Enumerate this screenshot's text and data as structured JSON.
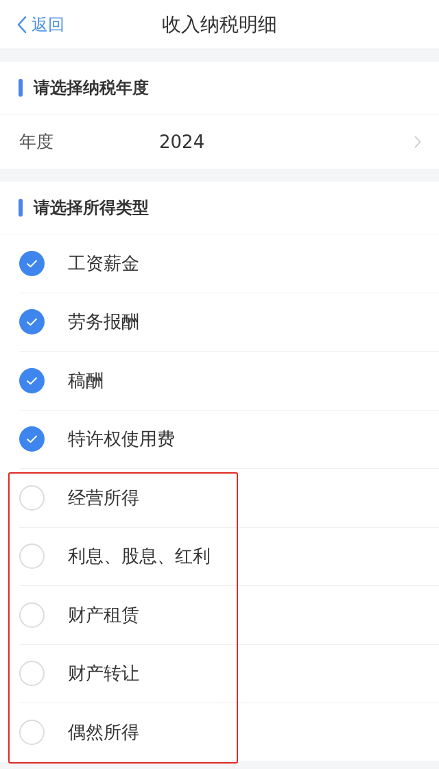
{
  "header": {
    "back_label": "返回",
    "title": "收入纳税明细"
  },
  "year_section": {
    "title": "请选择纳税年度",
    "field_label": "年度",
    "value": "2024"
  },
  "income_section": {
    "title": "请选择所得类型",
    "items": [
      {
        "label": "工资薪金",
        "checked": true,
        "highlighted": false
      },
      {
        "label": "劳务报酬",
        "checked": true,
        "highlighted": false
      },
      {
        "label": "稿酬",
        "checked": true,
        "highlighted": false
      },
      {
        "label": "特许权使用费",
        "checked": true,
        "highlighted": false
      },
      {
        "label": "经营所得",
        "checked": false,
        "highlighted": true
      },
      {
        "label": "利息、股息、红利",
        "checked": false,
        "highlighted": true
      },
      {
        "label": "财产租赁",
        "checked": false,
        "highlighted": true
      },
      {
        "label": "财产转让",
        "checked": false,
        "highlighted": true
      },
      {
        "label": "偶然所得",
        "checked": false,
        "highlighted": true
      }
    ]
  }
}
